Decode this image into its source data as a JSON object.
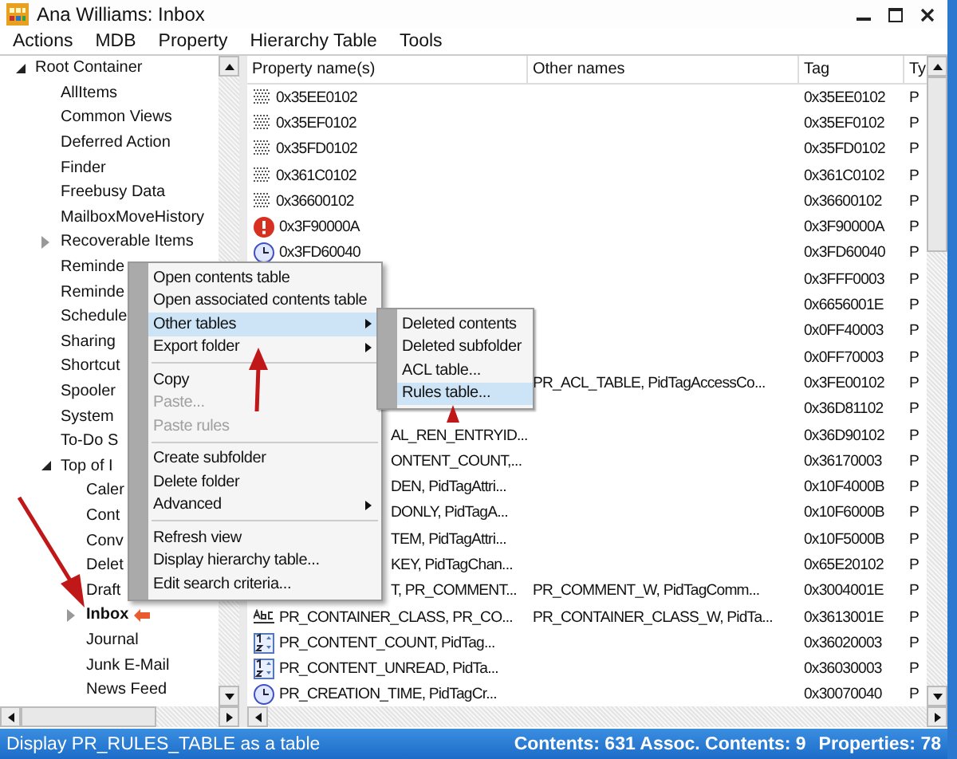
{
  "window": {
    "title": "Ana Williams: Inbox"
  },
  "menu_bar": [
    "Actions",
    "MDB",
    "Property",
    "Hierarchy Table",
    "Tools"
  ],
  "tree": [
    {
      "label": "Root Container",
      "bold": false,
      "expanded": true,
      "children": [
        {
          "label": "AllItems",
          "bold": false
        },
        {
          "label": "Common Views",
          "bold": false
        },
        {
          "label": "Deferred Action",
          "bold": false
        },
        {
          "label": "Finder",
          "bold": false
        },
        {
          "label": "Freebusy Data",
          "bold": false
        },
        {
          "label": "MailboxMoveHistory",
          "bold": false
        },
        {
          "label": "Recoverable Items",
          "bold": false,
          "expanded": false
        },
        {
          "label": "Reminde",
          "bold": false
        },
        {
          "label": "Reminde",
          "bold": false
        },
        {
          "label": "Schedule",
          "bold": false
        },
        {
          "label": "Sharing",
          "bold": false
        },
        {
          "label": "Shortcut",
          "bold": false
        },
        {
          "label": "Spooler",
          "bold": false
        },
        {
          "label": "System",
          "bold": false
        },
        {
          "label": "To-Do S",
          "bold": false
        },
        {
          "label": "Top of I",
          "bold": false,
          "expanded": true,
          "children": [
            {
              "label": "Caler",
              "bold": false
            },
            {
              "label": "Cont",
              "bold": false
            },
            {
              "label": "Conv",
              "bold": false
            },
            {
              "label": "Delet",
              "bold": false
            },
            {
              "label": "Draft",
              "bold": false
            },
            {
              "label": "Inbox",
              "bold": true,
              "expanded": false,
              "kind": "rules"
            },
            {
              "label": "Journal",
              "bold": false
            },
            {
              "label": "Junk E-Mail",
              "bold": false
            },
            {
              "label": "News Feed",
              "bold": false
            }
          ]
        }
      ]
    }
  ],
  "table": {
    "columns": [
      "Property name(s)",
      "Other names",
      "Tag",
      "Ty"
    ],
    "rows": [
      {
        "kind": "binary",
        "name": "0x35EE0102",
        "tag": "0x35EE0102",
        "type": "P"
      },
      {
        "kind": "binary",
        "name": "0x35EF0102",
        "tag": "0x35EF0102",
        "type": "P"
      },
      {
        "kind": "binary",
        "name": "0x35FD0102",
        "tag": "0x35FD0102",
        "type": "P"
      },
      {
        "kind": "binary",
        "name": "0x361C0102",
        "tag": "0x361C0102",
        "type": "P"
      },
      {
        "kind": "binary",
        "name": "0x36600102",
        "tag": "0x36600102",
        "type": "P"
      },
      {
        "kind": "error",
        "name": "0x3F90000A",
        "tag": "0x3F90000A",
        "type": "P"
      },
      {
        "kind": "time",
        "name": "0x3FD60040",
        "tag": "0x3FD60040",
        "type": "P"
      },
      {
        "kind": "hidden",
        "tag": "0x3FFF0003",
        "type": "P"
      },
      {
        "kind": "hidden",
        "tag": "0x6656001E",
        "type": "P"
      },
      {
        "kind": "hidden",
        "tag": "0x0FF40003",
        "type": "P"
      },
      {
        "kind": "hidden",
        "tag": "0x0FF70003",
        "type": "P"
      },
      {
        "kind": "hidden",
        "other": "PR_ACL_TABLE, PidTagAccessCo...",
        "tag": "0x3FE00102",
        "type": "P"
      },
      {
        "kind": "hidden",
        "tag": "0x36D81102",
        "type": "P"
      },
      {
        "kind": "covered",
        "name": "AL_REN_ENTRYID...",
        "tag": "0x36D90102",
        "type": "P"
      },
      {
        "kind": "covered",
        "name": "ONTENT_COUNT,...",
        "tag": "0x36170003",
        "type": "P"
      },
      {
        "kind": "covered",
        "name": "DEN, PidTagAttri...",
        "tag": "0x10F4000B",
        "type": "P"
      },
      {
        "kind": "covered",
        "name": "DONLY, PidTagA...",
        "tag": "0x10F6000B",
        "type": "P"
      },
      {
        "kind": "covered",
        "name": "TEM, PidTagAttri...",
        "tag": "0x10F5000B",
        "type": "P"
      },
      {
        "kind": "covered",
        "name": "KEY, PidTagChan...",
        "tag": "0x65E20102",
        "type": "P"
      },
      {
        "kind": "covered",
        "name": "T, PR_COMMENT...",
        "other": "PR_COMMENT_W, PidTagComm...",
        "tag": "0x3004001E",
        "type": "P"
      },
      {
        "kind": "string",
        "name": "PR_CONTAINER_CLASS, PR_CO...",
        "other": "PR_CONTAINER_CLASS_W, PidTa...",
        "tag": "0x3613001E",
        "type": "P"
      },
      {
        "kind": "number",
        "name": "PR_CONTENT_COUNT, PidTag...",
        "tag": "0x36020003",
        "type": "P"
      },
      {
        "kind": "number",
        "name": "PR_CONTENT_UNREAD, PidTa...",
        "tag": "0x36030003",
        "type": "P"
      },
      {
        "kind": "time",
        "name": "PR_CREATION_TIME, PidTagCr...",
        "tag": "0x30070040",
        "type": "P"
      }
    ]
  },
  "context_menu": {
    "items": [
      {
        "kind": "item",
        "label": "Open contents table",
        "selected": false,
        "disabled": false,
        "submenu": false
      },
      {
        "kind": "item",
        "label": "Open associated contents table",
        "selected": false,
        "disabled": false,
        "submenu": false
      },
      {
        "kind": "item",
        "label": "Other tables",
        "selected": true,
        "disabled": false,
        "submenu": true
      },
      {
        "kind": "item",
        "label": "Export folder",
        "selected": false,
        "disabled": false,
        "submenu": true
      },
      {
        "kind": "separator"
      },
      {
        "kind": "item",
        "label": "Copy",
        "selected": false,
        "disabled": false,
        "submenu": false
      },
      {
        "kind": "item",
        "label": "Paste...",
        "selected": false,
        "disabled": true,
        "submenu": false
      },
      {
        "kind": "item",
        "label": "Paste rules",
        "selected": false,
        "disabled": true,
        "submenu": false
      },
      {
        "kind": "separator"
      },
      {
        "kind": "item",
        "label": "Create subfolder",
        "selected": false,
        "disabled": false,
        "submenu": false
      },
      {
        "kind": "item",
        "label": "Delete folder",
        "selected": false,
        "disabled": false,
        "submenu": false
      },
      {
        "kind": "item",
        "label": "Advanced",
        "selected": false,
        "disabled": false,
        "submenu": true
      },
      {
        "kind": "separator"
      },
      {
        "kind": "item",
        "label": "Refresh view",
        "selected": false,
        "disabled": false,
        "submenu": false
      },
      {
        "kind": "item",
        "label": "Display hierarchy table...",
        "selected": false,
        "disabled": false,
        "submenu": false
      },
      {
        "kind": "item",
        "label": "Edit search criteria...",
        "selected": false,
        "disabled": false,
        "submenu": false
      }
    ]
  },
  "submenu": {
    "items": [
      {
        "label": "Deleted contents",
        "selected": false
      },
      {
        "label": "Deleted subfolder",
        "selected": false
      },
      {
        "label": "ACL table...",
        "selected": false
      },
      {
        "label": "Rules table...",
        "selected": true
      }
    ]
  },
  "status_bar": {
    "message": "Display PR_RULES_TABLE as a table",
    "contents": "Contents: 631 Assoc. Contents: 9",
    "properties": "Properties: 78"
  }
}
